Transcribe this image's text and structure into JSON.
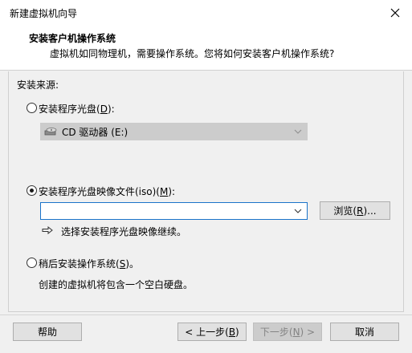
{
  "window": {
    "title": "新建虚拟机向导"
  },
  "header": {
    "title": "安装客户机操作系统",
    "subtitle": "虚拟机如同物理机，需要操作系统。您将如何安装客户机操作系统?"
  },
  "source": {
    "label": "安装来源:",
    "options": [
      {
        "label": "安装程序光盘(",
        "mnemonic": "D",
        "suffix": "):",
        "checked": false
      },
      {
        "label": "安装程序光盘映像文件(iso)(",
        "mnemonic": "M",
        "suffix": "):",
        "checked": true
      },
      {
        "label": "稍后安装操作系统(",
        "mnemonic": "S",
        "suffix": ")。",
        "checked": false
      }
    ],
    "cd_drive_value": "CD 驱动器 (E:)",
    "iso_path_value": "",
    "browse_label_prefix": "浏览(",
    "browse_mnemonic": "R",
    "browse_label_suffix": ")...",
    "iso_hint": "选择安装程序光盘映像继续。",
    "later_desc": "创建的虚拟机将包含一个空白硬盘。"
  },
  "footer": {
    "help_label": "帮助",
    "back_prefix": "< 上一步(",
    "back_mnemonic": "B",
    "back_suffix": ")",
    "next_prefix": "下一步(",
    "next_mnemonic": "N",
    "next_suffix": ") >",
    "cancel_label": "取消"
  }
}
